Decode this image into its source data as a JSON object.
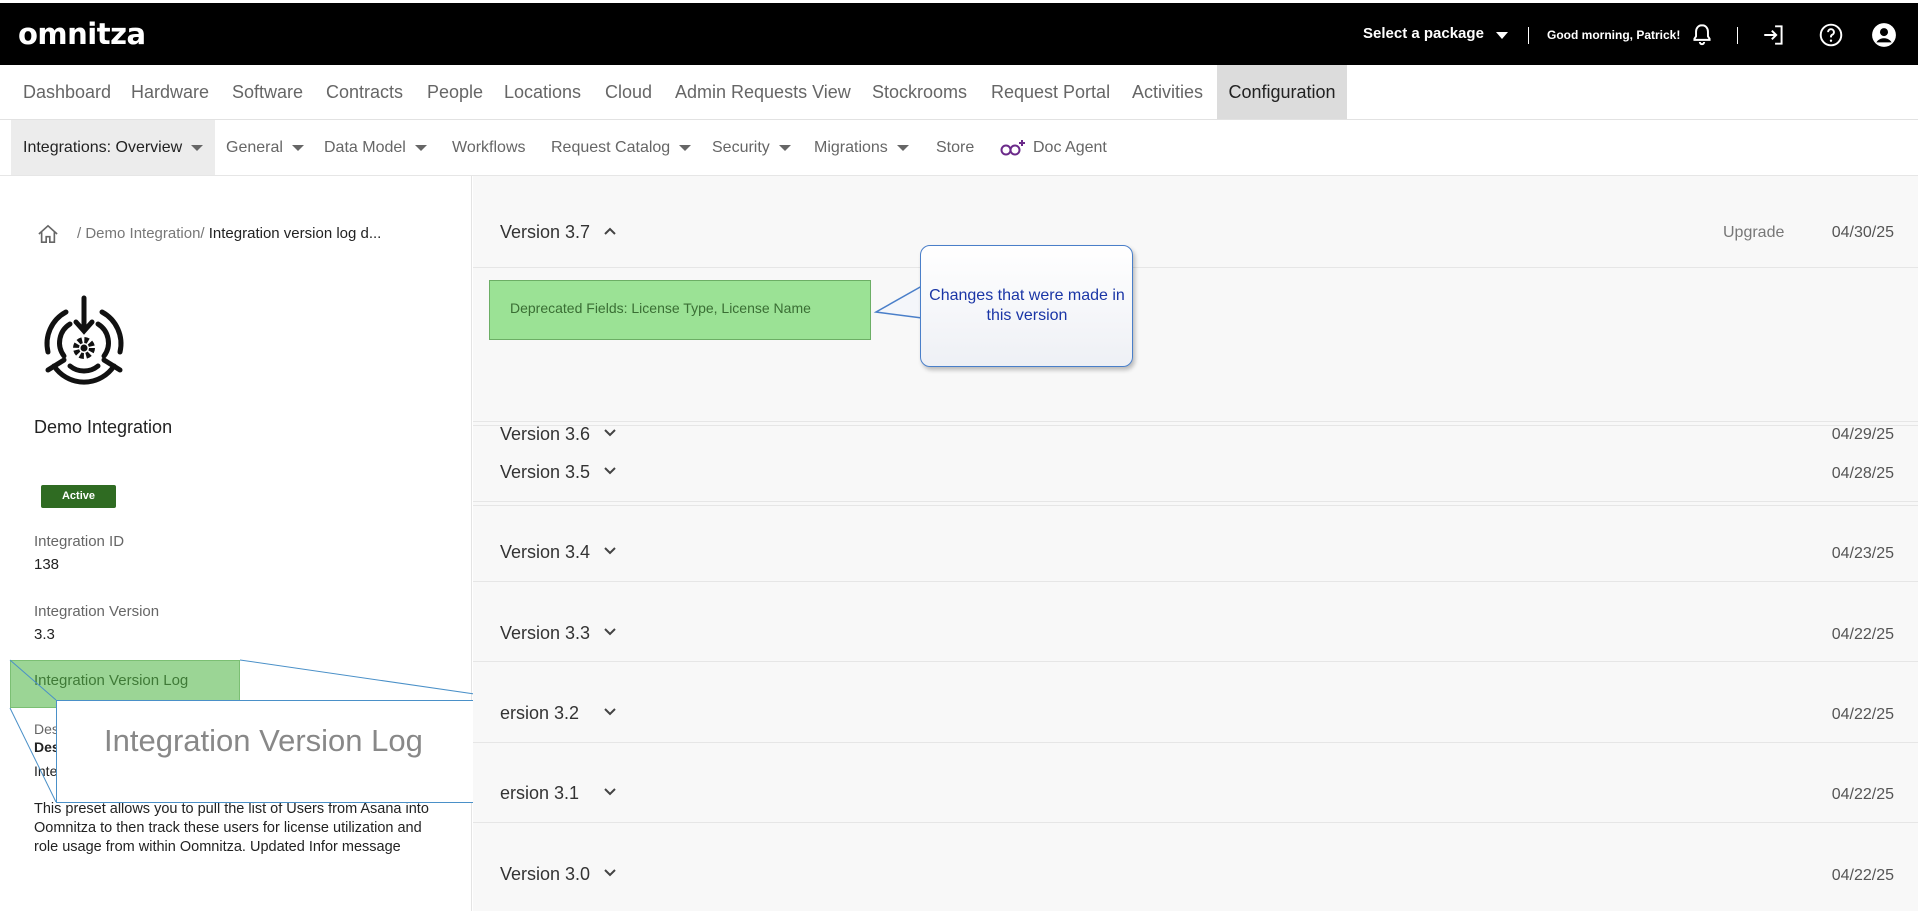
{
  "header": {
    "logo": "omnitza",
    "package_select": "Select a package",
    "greeting": "Good morning, Patrick!"
  },
  "nav_primary": [
    "Dashboard",
    "Hardware",
    "Software",
    "Contracts",
    "People",
    "Locations",
    "Cloud",
    "Admin Requests View",
    "Stockrooms",
    "Request Portal",
    "Activities",
    "Configuration"
  ],
  "nav_secondary": {
    "integrations": "Integrations: Overview",
    "general": "General",
    "data_model": "Data Model",
    "workflows": "Workflows",
    "request_catalog": "Request Catalog",
    "security": "Security",
    "migrations": "Migrations",
    "store": "Store",
    "doc_agent": "Doc Agent"
  },
  "breadcrumb": {
    "sep1": "/",
    "demo": "Demo Integration/",
    "current": "Integration version log d..."
  },
  "integration": {
    "title": "Demo Integration",
    "status": "Active",
    "id_label": "Integration ID",
    "id_value": "138",
    "version_label": "Integration Version",
    "version_value": "3.3",
    "log_label": "Integration Version Log",
    "desc_label": "Des",
    "desc_bold": "Des",
    "desc_sub": "Inte",
    "description": "This preset allows you to pull the list of Users from Asana into Oomnitza to then track these users for license utilization and role usage from within Oomnitza. Updated Infor message"
  },
  "zoom_label": "Integration Version Log",
  "versions": [
    {
      "title": "Version 3.7",
      "date": "04/30/25",
      "action": "Upgrade",
      "expanded": true
    },
    {
      "title": "Version 3.6",
      "date": "04/29/25"
    },
    {
      "title": "Version 3.5",
      "date": "04/28/25"
    },
    {
      "title": "Version 3.4",
      "date": "04/23/25"
    },
    {
      "title": "Version 3.3",
      "date": "04/22/25"
    },
    {
      "title": "ersion 3.2",
      "date": "04/22/25"
    },
    {
      "title": "ersion 3.1",
      "date": "04/22/25"
    },
    {
      "title": "Version 3.0",
      "date": "04/22/25"
    }
  ],
  "change_note": "Deprecated Fields: License Type, License Name",
  "callout": "Changes that were made in this version",
  "colors": {
    "topbar": "#000000",
    "active_badge": "#2f6b22",
    "highlight": "#9be295",
    "callout_text": "#1a35a6",
    "doc_agent": "#6b2a8a"
  }
}
